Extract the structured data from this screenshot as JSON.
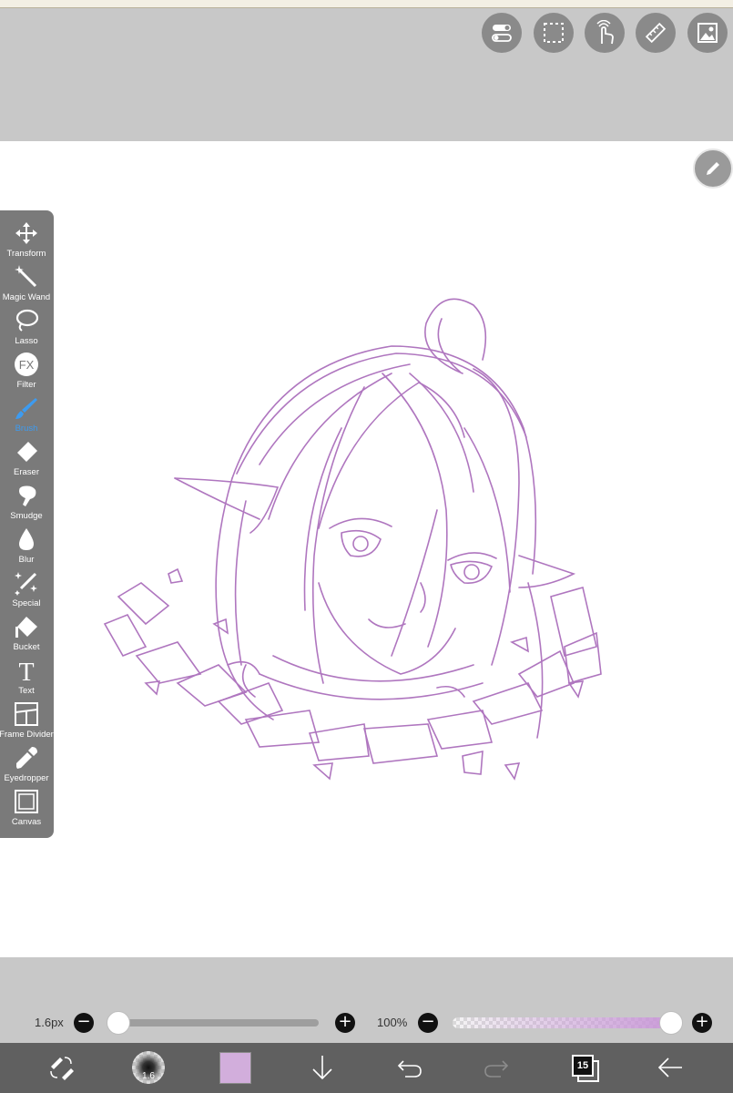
{
  "top_toolbar": {
    "buttons": [
      {
        "name": "toggle-switches-icon"
      },
      {
        "name": "selection-icon"
      },
      {
        "name": "touch-gesture-icon"
      },
      {
        "name": "ruler-icon"
      },
      {
        "name": "image-icon"
      }
    ]
  },
  "tools": [
    {
      "label": "Transform",
      "icon": "move-icon"
    },
    {
      "label": "Magic Wand",
      "icon": "magic-wand-icon"
    },
    {
      "label": "Lasso",
      "icon": "lasso-icon"
    },
    {
      "label": "Filter",
      "icon": "fx-icon",
      "icon_text": "FX"
    },
    {
      "label": "Brush",
      "icon": "brush-icon",
      "active": true
    },
    {
      "label": "Eraser",
      "icon": "eraser-icon"
    },
    {
      "label": "Smudge",
      "icon": "smudge-icon"
    },
    {
      "label": "Blur",
      "icon": "drop-icon"
    },
    {
      "label": "Special",
      "icon": "special-brush-icon"
    },
    {
      "label": "Bucket",
      "icon": "bucket-icon"
    },
    {
      "label": "Text",
      "icon": "text-icon",
      "icon_text": "T"
    },
    {
      "label": "Frame Divider",
      "icon": "frame-divider-icon"
    },
    {
      "label": "Eyedropper",
      "icon": "eyedropper-icon"
    },
    {
      "label": "Canvas",
      "icon": "canvas-icon"
    }
  ],
  "brush_controls": {
    "size_label": "1.6px",
    "size_min_symbol": "−",
    "size_plus_symbol": "+",
    "opacity_label": "100%",
    "opacity_min_symbol": "−",
    "opacity_plus_symbol": "+",
    "opacity_value": 1.0
  },
  "bottom_bar": {
    "brush_size_text": "1.6",
    "color_hex": "#d2aedc",
    "layer_count": "15"
  },
  "colors": {
    "sketch": "#a25fb4",
    "active_tool": "#3d9bf0",
    "toolbar_bg": "#7a7a7a",
    "panel_bg": "#c8c8c8"
  }
}
